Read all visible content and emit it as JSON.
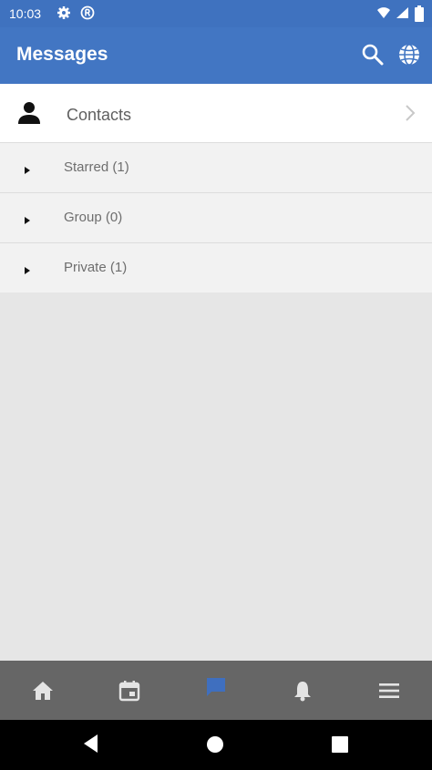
{
  "status_bar": {
    "time": "10:03",
    "left_icons": [
      "settings-icon",
      "registered-icon"
    ],
    "right_icons": [
      "wifi-icon",
      "cellular-signal-icon",
      "battery-icon"
    ]
  },
  "header": {
    "title": "Messages",
    "actions": [
      "search-icon",
      "globe-icon"
    ],
    "color": "#4276c3"
  },
  "contacts": {
    "label": "Contacts",
    "icon": "person-icon",
    "chevron": "chevron-right-icon"
  },
  "groups": [
    {
      "label": "Starred (1)"
    },
    {
      "label": "Group (0)"
    },
    {
      "label": "Private (1)"
    }
  ],
  "bottom_nav": {
    "items": [
      "home-icon",
      "calendar-icon",
      "messages-icon",
      "notifications-icon",
      "menu-icon"
    ],
    "active": "messages-icon",
    "active_color": "#3f6fbf"
  },
  "system_nav": {
    "items": [
      "back-icon",
      "home-circle-icon",
      "recents-icon"
    ]
  }
}
